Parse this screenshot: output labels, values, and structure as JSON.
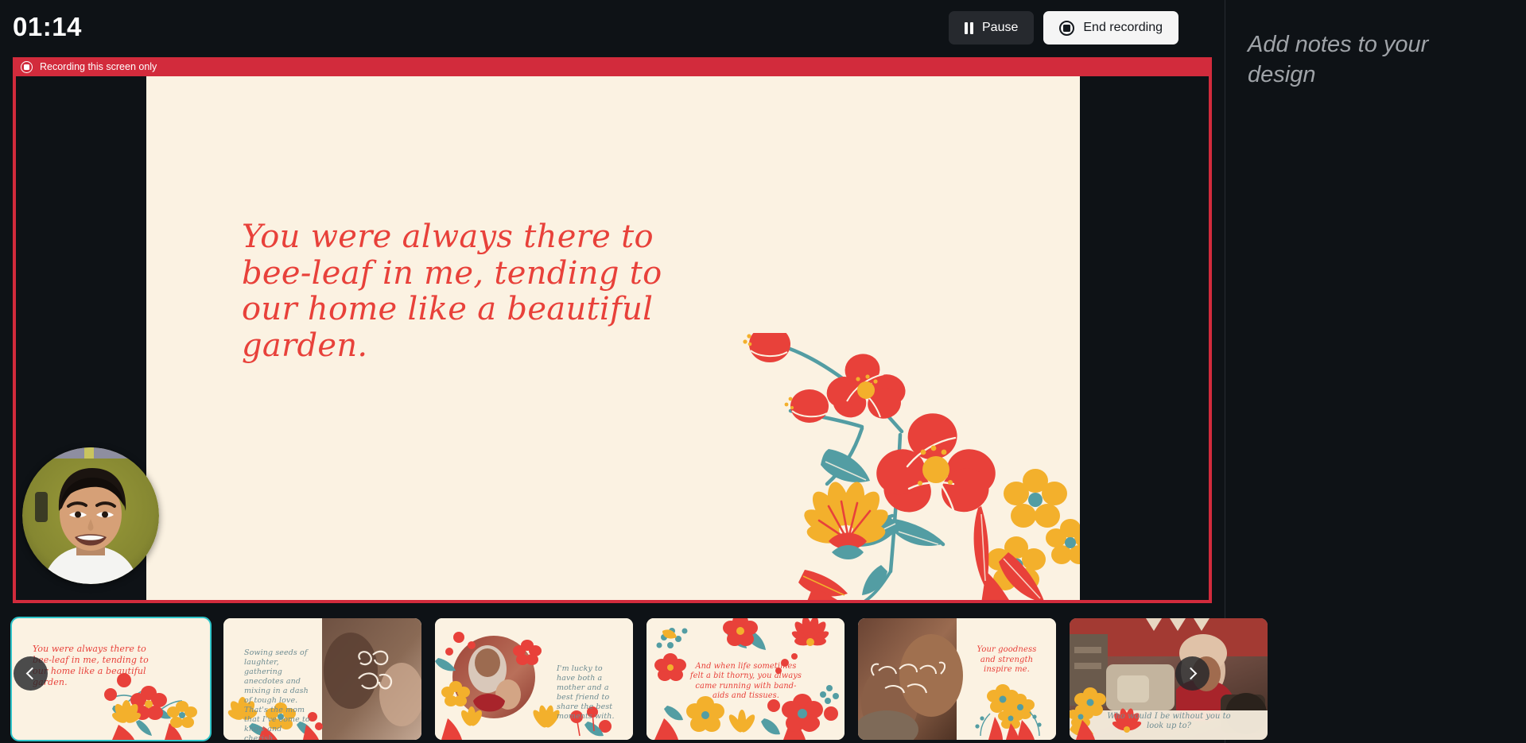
{
  "recorder": {
    "timer": "01:14",
    "pause_label": "Pause",
    "end_label": "End recording",
    "banner_text": "Recording this screen only",
    "banner_color": "#D22B3C",
    "pause_icon": "pause-icon",
    "end_icon": "stop-record-icon",
    "banner_icon": "record-indicator-icon"
  },
  "notes": {
    "placeholder": "Add notes to your design"
  },
  "slide": {
    "background_color": "#FBF2E2",
    "text_color": "#E8413A",
    "quote": "You were always there to bee-leaf in me, tending to our home like a beautiful garden."
  },
  "thumbnails": {
    "selected_index": 1,
    "selected_border_color": "#2EC4C9",
    "prev_label": "chevron-left-icon",
    "next_label": "chevron-right-icon",
    "items": [
      {
        "index": "1",
        "text": "You were always there to bee-leaf in me, tending to our home like a beautiful garden.",
        "text_color": "#E8413A"
      },
      {
        "index": "2",
        "text": "Sowing seeds of laughter, gathering anecdotes and mixing in a dash of tough love. That's the mom that I've come to know and cherish.",
        "text_color": "#6E8C92",
        "photo_caption": "No.1 Mom"
      },
      {
        "index": "3",
        "text": "I'm lucky to have both a mother and a best friend to share the best moments with.",
        "text_color": "#6E8C92"
      },
      {
        "index": "4",
        "text": "And when life sometimes felt a bit thorny, you always came running with band-aids and tissues.",
        "text_color": "#E8413A"
      },
      {
        "index": "5",
        "text": "Your goodness and strength inspire me.",
        "text_color": "#E8413A",
        "photo_caption": "MOM YOU ARE Amazing"
      },
      {
        "index": "6",
        "text": "Who would I be without you to look up to?",
        "text_color": "#6E8C92"
      }
    ]
  },
  "palette": {
    "red": "#E8413A",
    "yellow": "#F3B02C",
    "teal": "#539DA3",
    "cream": "#FBF2E2",
    "dark": "#0E1216"
  }
}
